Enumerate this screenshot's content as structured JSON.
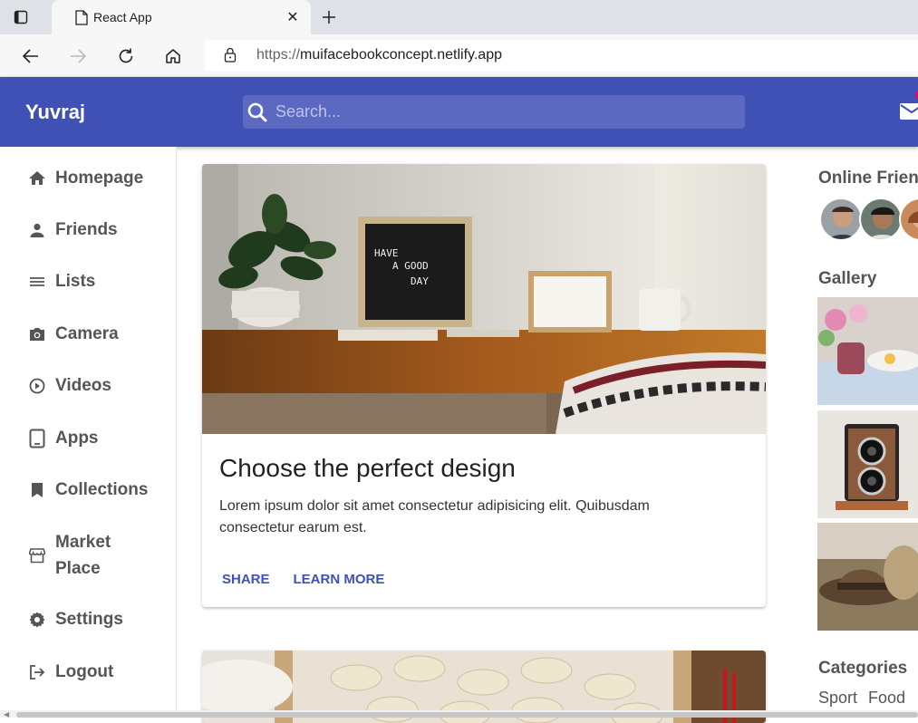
{
  "browser": {
    "tab_title": "React App",
    "url_scheme": "https://",
    "url_host": "muifacebookconcept.netlify.app"
  },
  "appbar": {
    "brand": "Yuvraj",
    "search_placeholder": "Search...",
    "color": "#3f51b5",
    "mail_badge_color": "#f50057"
  },
  "sidebar": {
    "items": [
      {
        "label": "Homepage",
        "icon": "home-icon"
      },
      {
        "label": "Friends",
        "icon": "person-icon"
      },
      {
        "label": "Lists",
        "icon": "list-icon"
      },
      {
        "label": "Camera",
        "icon": "camera-icon"
      },
      {
        "label": "Videos",
        "icon": "play-circle-icon"
      },
      {
        "label": "Apps",
        "icon": "tablet-icon"
      },
      {
        "label": "Collections",
        "icon": "bookmark-icon"
      },
      {
        "label": "Market Place",
        "icon": "storefront-icon"
      },
      {
        "label": "Settings",
        "icon": "settings-icon"
      },
      {
        "label": "Logout",
        "icon": "logout-icon"
      }
    ]
  },
  "feed": {
    "post": {
      "title": "Choose the perfect design",
      "body": "Lorem ipsum dolor sit amet consectetur adipisicing elit. Quibusdam consectetur earum est.",
      "share_label": "SHARE",
      "learn_more_label": "LEARN MORE",
      "image_letterboard": [
        "HAVE",
        "A GOOD",
        "DAY"
      ]
    }
  },
  "rightbar": {
    "online_title": "Online Friends",
    "gallery_title": "Gallery",
    "categories_title": "Categories",
    "categories": [
      "Sport",
      "Food"
    ]
  }
}
